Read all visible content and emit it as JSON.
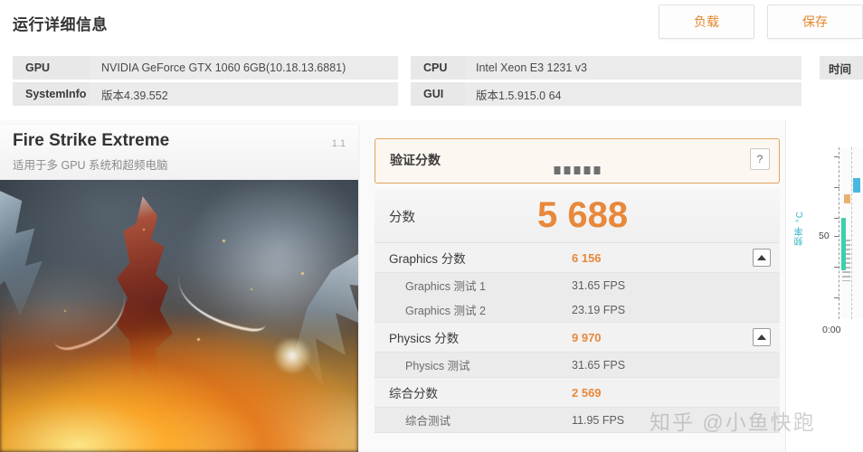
{
  "header": {
    "title": "运行详细信息",
    "buttons": [
      {
        "name": "load",
        "label": "负载"
      },
      {
        "name": "save",
        "label": "保存"
      }
    ]
  },
  "sysinfo": {
    "left": [
      {
        "label": "GPU",
        "value": "NVIDIA GeForce GTX 1060 6GB(10.18.13.6881)"
      },
      {
        "label": "SystemInfo",
        "value": "版本4.39.552"
      }
    ],
    "middle": [
      {
        "label": "CPU",
        "value": "Intel Xeon E3 1231 v3"
      },
      {
        "label": "GUI",
        "value": "版本1.5.915.0 64"
      }
    ],
    "right": [
      {
        "label": "时间"
      }
    ]
  },
  "benchmark": {
    "name": "Fire Strike Extreme",
    "subtitle": "适用于多 GPU 系统和超频电脑",
    "version": "1.1"
  },
  "scores": {
    "verify": {
      "label": "验证分数",
      "help_label": "?",
      "masked_chars": 5
    },
    "total": {
      "label": "分数",
      "value": "5 688"
    },
    "rows": [
      {
        "type": "main",
        "label": "Graphics 分数",
        "value": "6 156",
        "collapsible": true
      },
      {
        "type": "sub",
        "label": "Graphics 测试 1",
        "value": "31.65 FPS"
      },
      {
        "type": "sub",
        "label": "Graphics 测试 2",
        "value": "23.19 FPS"
      },
      {
        "type": "main",
        "label": "Physics 分数",
        "value": "9 970",
        "collapsible": true
      },
      {
        "type": "sub",
        "label": "Physics 测试",
        "value": "31.65 FPS"
      },
      {
        "type": "main",
        "label": "综合分数",
        "value": "2 569",
        "collapsible": false
      },
      {
        "type": "sub",
        "label": "综合测试",
        "value": "11.95 FPS"
      }
    ]
  },
  "chart_data": {
    "type": "line",
    "title": "",
    "ylabel": "频率 °C",
    "xlabel": "",
    "y_ticks": [
      "50"
    ],
    "x_ticks": [
      "0:00"
    ],
    "grid": true,
    "legend": "none",
    "note": "仅可见图表最左侧边缘",
    "series": [
      {
        "name": "teal",
        "color": "#3ccfae"
      },
      {
        "name": "blue",
        "color": "#49b7e0"
      },
      {
        "name": "orange",
        "color": "#e4a257"
      },
      {
        "name": "grey",
        "color": "#b9b9b9"
      }
    ]
  },
  "watermark": {
    "text": "知乎 @小鱼快跑"
  },
  "colors": {
    "accent_orange": "#e8883a",
    "verify_border": "#e0a45e",
    "teal": "#2fb5c4"
  }
}
